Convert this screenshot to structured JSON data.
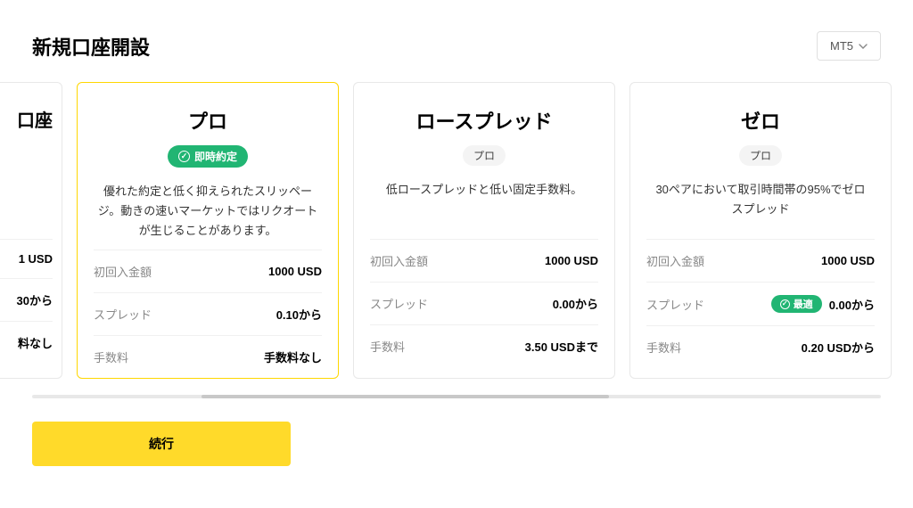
{
  "header": {
    "title": "新規口座開設",
    "platform_selected": "MT5"
  },
  "cards": {
    "partial_left": {
      "title_fragment": "口座",
      "spec0_value": "1 USD",
      "spec1_value": "30から",
      "spec2_value": "料なし"
    },
    "pro": {
      "title": "プロ",
      "instant_badge": "即時約定",
      "description": "優れた約定と低く抑えられたスリッページ。動きの速いマーケットではリクオートが生じることがあります。",
      "spec0_label": "初回入金額",
      "spec0_value": "1000 USD",
      "spec1_label": "スプレッド",
      "spec1_value": "0.10から",
      "spec2_label": "手数料",
      "spec2_value": "手数料なし"
    },
    "raw": {
      "title": "ロースプレッド",
      "sub_badge": "プロ",
      "description": "低ロースプレッドと低い固定手数料。",
      "spec0_label": "初回入金額",
      "spec0_value": "1000 USD",
      "spec1_label": "スプレッド",
      "spec1_value": "0.00から",
      "spec2_label": "手数料",
      "spec2_value": "3.50 USDまで"
    },
    "zero": {
      "title": "ゼロ",
      "sub_badge": "プロ",
      "description": "30ペアにおいて取引時間帯の95%でゼロスプレッド",
      "spec0_label": "初回入金額",
      "spec0_value": "1000 USD",
      "spec1_label": "スプレッド",
      "spec1_optimal": "最適",
      "spec1_value": "0.00から",
      "spec2_label": "手数料",
      "spec2_value": "0.20 USDから"
    }
  },
  "footer": {
    "continue_label": "続行"
  }
}
